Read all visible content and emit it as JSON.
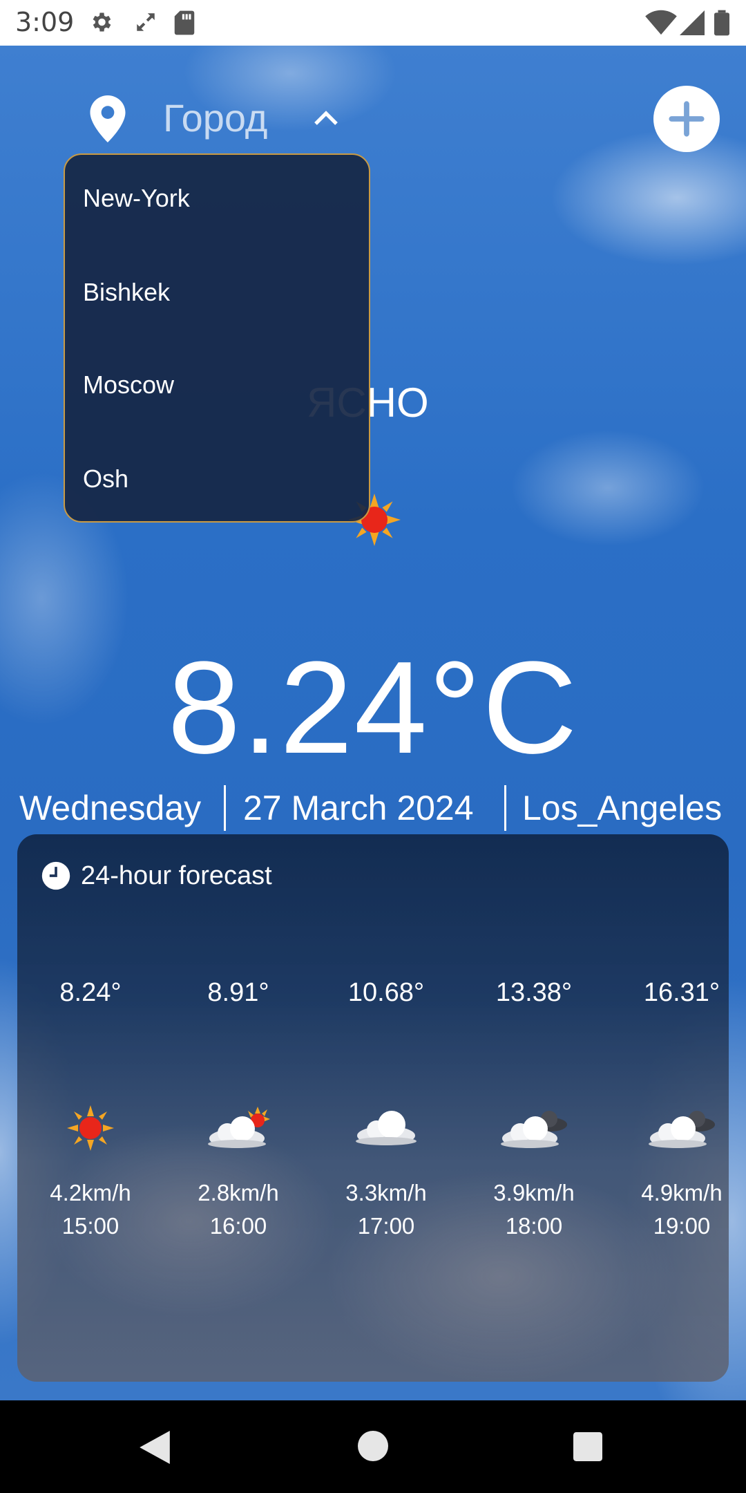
{
  "status_bar": {
    "time": "3:09",
    "icons": [
      "settings-icon",
      "resize-icon",
      "sd-card-icon",
      "wifi-icon",
      "signal-icon",
      "battery-icon"
    ]
  },
  "header": {
    "city_placeholder": "Город",
    "icons": [
      "location-pin-icon",
      "chevron-up-icon",
      "add-icon"
    ]
  },
  "dropdown": {
    "options": [
      "New-York",
      "Bishkek",
      "Moscow",
      "Osh"
    ],
    "border_color": "#c99a44"
  },
  "current": {
    "condition": "ЯСНО",
    "icon": "sun-icon",
    "temperature": "8.24°C",
    "day": "Wednesday",
    "date": "27 March 2024",
    "location": "Los_Angeles"
  },
  "forecast": {
    "title": "24-hour forecast",
    "title_icon": "clock-icon",
    "hours": [
      {
        "temp": "8.24°",
        "icon": "sun-icon",
        "wind": "4.2km/h",
        "time": "15:00"
      },
      {
        "temp": "8.91°",
        "icon": "cloud-sun-icon",
        "wind": "2.8km/h",
        "time": "16:00"
      },
      {
        "temp": "10.68°",
        "icon": "cloud-icon",
        "wind": "3.3km/h",
        "time": "17:00"
      },
      {
        "temp": "13.38°",
        "icon": "cloud-dark-icon",
        "wind": "3.9km/h",
        "time": "18:00"
      },
      {
        "temp": "16.31°",
        "icon": "cloud-dark-icon",
        "wind": "4.9km/h",
        "time": "19:00"
      }
    ]
  },
  "nav_bar": {
    "icons": [
      "back-icon",
      "home-icon",
      "recents-icon"
    ]
  }
}
